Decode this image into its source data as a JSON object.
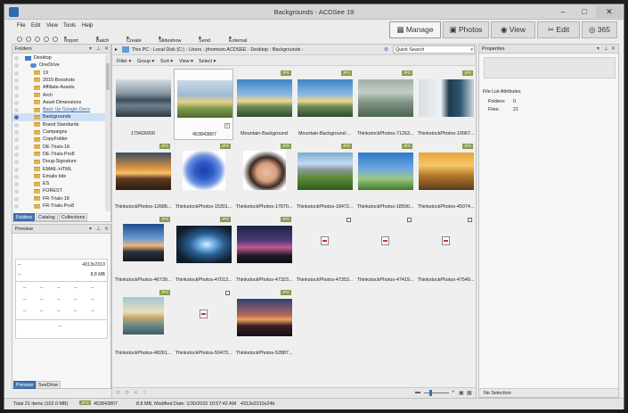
{
  "window": {
    "title": "Backgrounds - ACDSee 19"
  },
  "menu": [
    "File",
    "Edit",
    "View",
    "Tools",
    "Help"
  ],
  "modes": [
    {
      "label": "Manage",
      "icon": "grid-icon",
      "active": true
    },
    {
      "label": "Photos",
      "icon": "photos-icon",
      "active": false
    },
    {
      "label": "View",
      "icon": "eye-icon",
      "active": false
    },
    {
      "label": "Edit",
      "icon": "edit-tools-icon",
      "active": false
    },
    {
      "label": "365",
      "icon": "cloud-365-icon",
      "active": false
    }
  ],
  "toolbar": [
    "Import",
    "Batch",
    "Create",
    "Slideshow",
    "Send",
    "External Editors"
  ],
  "folders_pane": {
    "title": "Folders",
    "items": [
      {
        "label": "Desktop",
        "type": "desktop"
      },
      {
        "label": "OneDrive",
        "type": "cloud"
      },
      {
        "label": "19",
        "type": "folder"
      },
      {
        "label": "2015-Boxshots",
        "type": "folder"
      },
      {
        "label": "Affiliate-Assets",
        "type": "folder"
      },
      {
        "label": "Arch",
        "type": "folder"
      },
      {
        "label": "Asset Dimensions",
        "type": "folder"
      },
      {
        "label": "Back Up Google Docs",
        "type": "folder",
        "link": true
      },
      {
        "label": "Backgrounds",
        "type": "folder",
        "selected": true
      },
      {
        "label": "Brand Standards",
        "type": "folder"
      },
      {
        "label": "Campaigns",
        "type": "folder"
      },
      {
        "label": "CopyFolder",
        "type": "folder"
      },
      {
        "label": "DE-Trials-18",
        "type": "folder"
      },
      {
        "label": "DE-Trials-Pro8",
        "type": "folder"
      },
      {
        "label": "Doug-Signature",
        "type": "folder"
      },
      {
        "label": "EMAIL-HTML",
        "type": "folder"
      },
      {
        "label": "Emails bits",
        "type": "folder"
      },
      {
        "label": "ES",
        "type": "folder"
      },
      {
        "label": "FOREST",
        "type": "folder"
      },
      {
        "label": "FR-Trials-18",
        "type": "folder"
      },
      {
        "label": "FR-Trials-Pro8",
        "type": "folder"
      }
    ],
    "tabs": [
      "Folders",
      "Catalog",
      "Collections"
    ]
  },
  "preview_pane": {
    "title": "Preview",
    "dims": "4313x2310",
    "size": "8.8 MB",
    "dash": "--",
    "tabs": [
      "Preview",
      "SeeDrive"
    ]
  },
  "path": [
    "This PC",
    "Local Disk (C:)",
    "Users",
    "jthomson.ACDSEE",
    "Desktop",
    "Backgrounds"
  ],
  "search_placeholder": "Quick Search",
  "filter_bar": [
    "Filter",
    "Group",
    "Sort",
    "View",
    "Select"
  ],
  "thumbnails": [
    {
      "caption": "179426000",
      "badge": "",
      "kind": "stormy-sea"
    },
    {
      "caption": "453843807",
      "badge": "",
      "kind": "landscape",
      "selected": true
    },
    {
      "caption": "Mountain-Background",
      "badge": "JPG",
      "kind": "mountain"
    },
    {
      "caption": "Mountain-Background-...",
      "badge": "JPG",
      "kind": "mountain"
    },
    {
      "caption": "ThinkstockPhotos-71263...",
      "badge": "JPG",
      "kind": "foggy"
    },
    {
      "caption": "ThinkstockPhotos-10067...",
      "badge": "JPG",
      "kind": "computer"
    },
    {
      "caption": "ThinkstockPhotos-12686...",
      "badge": "JPG",
      "kind": "pier"
    },
    {
      "caption": "ThinkstockPhotos-15301...",
      "badge": "JPG",
      "kind": "blue-paint"
    },
    {
      "caption": "ThinkstockPhotos-17870...",
      "badge": "JPG",
      "kind": "woman"
    },
    {
      "caption": "ThinkstockPhotos-18472...",
      "badge": "JPG",
      "kind": "green-hills"
    },
    {
      "caption": "ThinkstockPhotos-18590...",
      "badge": "JPG",
      "kind": "birds-sky"
    },
    {
      "caption": "ThinkstockPhotos-45074...",
      "badge": "JPG",
      "kind": "sunset-hills"
    },
    {
      "caption": "ThinkstockPhotos-46739...",
      "badge": "JPG",
      "kind": "dusk-rock"
    },
    {
      "caption": "ThinkstockPhotos-47013...",
      "badge": "JPG",
      "kind": "speed"
    },
    {
      "caption": "ThinkstockPhotos-47323...",
      "badge": "JPG",
      "kind": "night-purple"
    },
    {
      "caption": "ThinkstockPhotos-47353...",
      "badge": "",
      "kind": "file"
    },
    {
      "caption": "ThinkstockPhotos-47419...",
      "badge": "",
      "kind": "file"
    },
    {
      "caption": "ThinkstockPhotos-47549...",
      "badge": "",
      "kind": "file"
    },
    {
      "caption": "ThinkstockPhotos-48261...",
      "badge": "JPG",
      "kind": "misty-mountain"
    },
    {
      "caption": "ThinkstockPhotos-50473...",
      "badge": "",
      "kind": "file"
    },
    {
      "caption": "ThinkstockPhotos-52887...",
      "badge": "JPG",
      "kind": "silhouette"
    }
  ],
  "properties_pane": {
    "title": "Properties",
    "section": "File List Attributes",
    "rows": [
      {
        "label": "Folders:",
        "value": "0"
      },
      {
        "label": "Files:",
        "value": "21"
      }
    ],
    "footer": "No Selection"
  },
  "status": {
    "total": "Total 21 items  (102.0 MB)",
    "badge": "JPG",
    "file": "453843807",
    "info": "8.8 MB, Modified Date: 1/30/2015 10:57:42 AM",
    "dims": "4313x2310x24b"
  }
}
